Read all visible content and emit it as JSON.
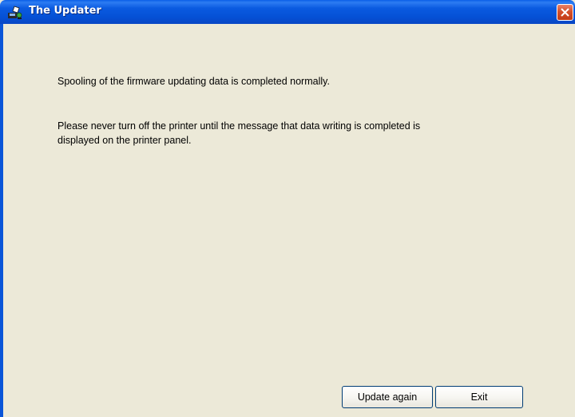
{
  "window": {
    "title": "The Updater",
    "close_icon": "close-icon"
  },
  "content": {
    "message_line1": "Spooling of the firmware updating data is completed normally.",
    "message_line2": "Please never turn off the printer until the message that data writing is completed is",
    "message_line3": "displayed on the printer panel."
  },
  "buttons": {
    "update_again": "Update again",
    "exit": "Exit"
  },
  "colors": {
    "title_bar": "#0551d6",
    "window_bg": "#ece9d8",
    "close_button": "#d4512c"
  }
}
